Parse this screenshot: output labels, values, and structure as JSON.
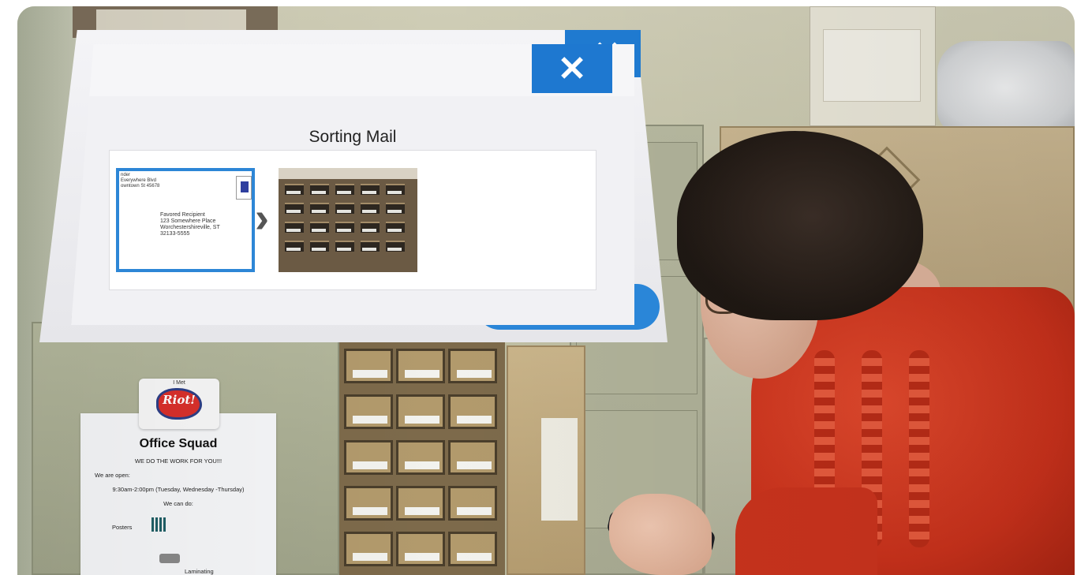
{
  "dialog": {
    "title": "Sorting Mail",
    "close_glyph": "✕",
    "back_close_glyph": "✕",
    "arrow_glyph": "›"
  },
  "envelope": {
    "from_lines": [
      "nder",
      "Everywhere Blvd",
      "owntown St 45678"
    ],
    "to_lines": [
      "Favored Recipient",
      "123 Somewhere Place",
      "Worchestershireville, ST",
      "32133-5555"
    ]
  },
  "sign": {
    "logo_small": "I Met",
    "logo_text": "Riot!",
    "title": "Office Squad",
    "line1": "WE DO THE WORK FOR YOU!!!",
    "line2": "We are open:",
    "line3": "9:30am-2:00pm (Tuesday, Wednesday -Thursday)",
    "line4": "We can do:",
    "line5": "Posters",
    "line6": "Laminating"
  },
  "colors": {
    "accent_blue": "#1e78d0",
    "sweater_red": "#d8391f"
  },
  "icons": {
    "close": "close-icon",
    "arrow": "chevron-right-icon"
  }
}
